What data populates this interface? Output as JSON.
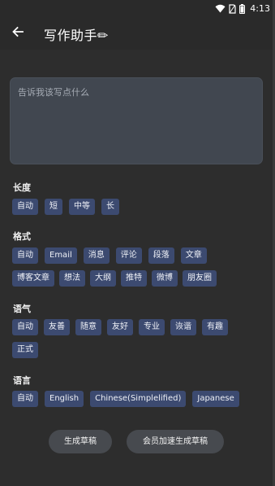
{
  "status_bar": {
    "time": "4:13",
    "icons": [
      "wifi-icon",
      "sim-icon",
      "battery-icon"
    ]
  },
  "app_bar": {
    "back_icon": "arrow-left-icon",
    "title": "写作助手✏"
  },
  "prompt": {
    "placeholder": "告诉我该写点什么",
    "value": ""
  },
  "sections": {
    "length": {
      "title": "长度",
      "options": [
        "自动",
        "短",
        "中等",
        "长"
      ]
    },
    "format": {
      "title": "格式",
      "options_row1": [
        "自动",
        "Email",
        "消息",
        "评论",
        "段落",
        "文章"
      ],
      "options_row2": [
        "博客文章",
        "想法",
        "大纲",
        "推特",
        "微博",
        "朋友圈"
      ]
    },
    "tone": {
      "title": "语气",
      "options_row1": [
        "自动",
        "友善",
        "随意",
        "友好",
        "专业",
        "诙谐",
        "有趣"
      ],
      "options_row2": [
        "正式"
      ]
    },
    "language": {
      "title": "语言",
      "options": [
        "自动",
        "English",
        "Chinese(Simplelified)",
        "Japanese"
      ]
    }
  },
  "actions": {
    "generate": "生成草稿",
    "member_generate": "会员加速生成草稿"
  },
  "colors": {
    "background": "#2d2d2d",
    "chip": "#3c4a70",
    "input": "#414750",
    "button": "#474a4f"
  }
}
